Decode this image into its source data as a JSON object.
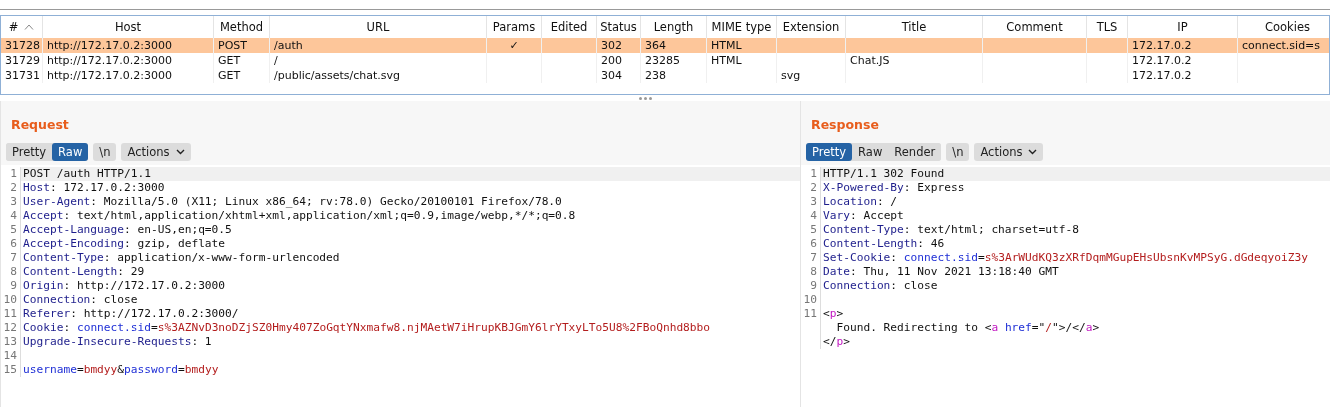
{
  "table": {
    "columns": [
      {
        "label": "#",
        "sorted": true
      },
      {
        "label": "Host",
        "sorted": false
      },
      {
        "label": "Method",
        "sorted": false
      },
      {
        "label": "URL",
        "sorted": false
      },
      {
        "label": "Params",
        "sorted": false
      },
      {
        "label": "Edited",
        "sorted": false
      },
      {
        "label": "Status",
        "sorted": false
      },
      {
        "label": "Length",
        "sorted": false
      },
      {
        "label": "MIME type",
        "sorted": false
      },
      {
        "label": "Extension",
        "sorted": false
      },
      {
        "label": "Title",
        "sorted": false
      },
      {
        "label": "Comment",
        "sorted": false
      },
      {
        "label": "TLS",
        "sorted": false
      },
      {
        "label": "IP",
        "sorted": false
      },
      {
        "label": "Cookies",
        "sorted": false
      }
    ],
    "rows": [
      {
        "selected": true,
        "cells": [
          "31728",
          "http://172.17.0.2:3000",
          "POST",
          "/auth",
          "✓",
          null,
          "302",
          "364",
          "HTML",
          null,
          null,
          null,
          null,
          "172.17.0.2",
          "connect.sid=s"
        ]
      },
      {
        "selected": false,
        "cells": [
          "31729",
          "http://172.17.0.2:3000",
          "GET",
          "/",
          null,
          null,
          "200",
          "23285",
          "HTML",
          null,
          "Chat.JS",
          null,
          null,
          "172.17.0.2",
          null
        ]
      },
      {
        "selected": false,
        "cells": [
          "31731",
          "http://172.17.0.2:3000",
          "GET",
          "/public/assets/chat.svg",
          null,
          null,
          "304",
          "238",
          null,
          "svg",
          null,
          null,
          null,
          "172.17.0.2",
          null
        ]
      }
    ]
  },
  "panes": [
    {
      "title": "Request",
      "views": [
        {
          "label": "Pretty",
          "selected": false
        },
        {
          "label": "Raw",
          "selected": true
        }
      ],
      "newline_button": "\\n",
      "actions_button": "Actions",
      "lines": [
        {
          "number": "1",
          "highlighted": true,
          "segments": [
            {
              "kind": "plain",
              "text": "POST /auth HTTP/1.1"
            }
          ]
        },
        {
          "number": "2",
          "highlighted": false,
          "segments": [
            {
              "kind": "name",
              "text": "Host"
            },
            {
              "kind": "plain",
              "text": ": 172.17.0.2:3000"
            }
          ]
        },
        {
          "number": "3",
          "highlighted": false,
          "segments": [
            {
              "kind": "name",
              "text": "User-Agent"
            },
            {
              "kind": "plain",
              "text": ": Mozilla/5.0 (X11; Linux x86_64; rv:78.0) Gecko/20100101 Firefox/78.0"
            }
          ]
        },
        {
          "number": "4",
          "highlighted": false,
          "segments": [
            {
              "kind": "name",
              "text": "Accept"
            },
            {
              "kind": "plain",
              "text": ": text/html,application/xhtml+xml,application/xml;q=0.9,image/webp,*/*;q=0.8"
            }
          ]
        },
        {
          "number": "5",
          "highlighted": false,
          "segments": [
            {
              "kind": "name",
              "text": "Accept-Language"
            },
            {
              "kind": "plain",
              "text": ": en-US,en;q=0.5"
            }
          ]
        },
        {
          "number": "6",
          "highlighted": false,
          "segments": [
            {
              "kind": "name",
              "text": "Accept-Encoding"
            },
            {
              "kind": "plain",
              "text": ": gzip, deflate"
            }
          ]
        },
        {
          "number": "7",
          "highlighted": false,
          "segments": [
            {
              "kind": "name",
              "text": "Content-Type"
            },
            {
              "kind": "plain",
              "text": ": application/x-www-form-urlencoded"
            }
          ]
        },
        {
          "number": "8",
          "highlighted": false,
          "segments": [
            {
              "kind": "name",
              "text": "Content-Length"
            },
            {
              "kind": "plain",
              "text": ": 29"
            }
          ]
        },
        {
          "number": "9",
          "highlighted": false,
          "segments": [
            {
              "kind": "name",
              "text": "Origin"
            },
            {
              "kind": "plain",
              "text": ": http://172.17.0.2:3000"
            }
          ]
        },
        {
          "number": "10",
          "highlighted": false,
          "segments": [
            {
              "kind": "name",
              "text": "Connection"
            },
            {
              "kind": "plain",
              "text": ": close"
            }
          ]
        },
        {
          "number": "11",
          "highlighted": false,
          "segments": [
            {
              "kind": "name",
              "text": "Referer"
            },
            {
              "kind": "plain",
              "text": ": http://172.17.0.2:3000/"
            }
          ]
        },
        {
          "number": "12",
          "highlighted": false,
          "segments": [
            {
              "kind": "name",
              "text": "Cookie"
            },
            {
              "kind": "plain",
              "text": ": "
            },
            {
              "kind": "attr",
              "text": "connect.sid"
            },
            {
              "kind": "plain",
              "text": "="
            },
            {
              "kind": "value",
              "text": "s%3AZNvD3noDZjSZ0Hmy407ZoGqtYNxmafw8.njMAetW7iHrupKBJGmY6lrYTxyLTo5U8%2FBoQnhd8bbo"
            }
          ]
        },
        {
          "number": "13",
          "highlighted": false,
          "segments": [
            {
              "kind": "name",
              "text": "Upgrade-Insecure-Requests"
            },
            {
              "kind": "plain",
              "text": ": 1"
            }
          ]
        },
        {
          "number": "14",
          "highlighted": false
        },
        {
          "number": "15",
          "highlighted": false,
          "segments": [
            {
              "kind": "attr",
              "text": "username"
            },
            {
              "kind": "plain",
              "text": "="
            },
            {
              "kind": "value",
              "text": "bmdyy"
            },
            {
              "kind": "plain",
              "text": "&"
            },
            {
              "kind": "attr",
              "text": "password"
            },
            {
              "kind": "plain",
              "text": "="
            },
            {
              "kind": "value",
              "text": "bmdyy"
            }
          ]
        }
      ]
    },
    {
      "title": "Response",
      "views": [
        {
          "label": "Pretty",
          "selected": true
        },
        {
          "label": "Raw",
          "selected": false
        },
        {
          "label": "Render",
          "selected": false
        }
      ],
      "newline_button": "\\n",
      "actions_button": "Actions",
      "lines": [
        {
          "number": "1",
          "highlighted": true,
          "segments": [
            {
              "kind": "plain",
              "text": "HTTP/1.1 302 Found"
            }
          ]
        },
        {
          "number": "2",
          "highlighted": false,
          "segments": [
            {
              "kind": "name",
              "text": "X-Powered-By"
            },
            {
              "kind": "plain",
              "text": ": Express"
            }
          ]
        },
        {
          "number": "3",
          "highlighted": false,
          "segments": [
            {
              "kind": "name",
              "text": "Location"
            },
            {
              "kind": "plain",
              "text": ": /"
            }
          ]
        },
        {
          "number": "4",
          "highlighted": false,
          "segments": [
            {
              "kind": "name",
              "text": "Vary"
            },
            {
              "kind": "plain",
              "text": ": Accept"
            }
          ]
        },
        {
          "number": "5",
          "highlighted": false,
          "segments": [
            {
              "kind": "name",
              "text": "Content-Type"
            },
            {
              "kind": "plain",
              "text": ": text/html; charset=utf-8"
            }
          ]
        },
        {
          "number": "6",
          "highlighted": false,
          "segments": [
            {
              "kind": "name",
              "text": "Content-Length"
            },
            {
              "kind": "plain",
              "text": ": 46"
            }
          ]
        },
        {
          "number": "7",
          "highlighted": false,
          "segments": [
            {
              "kind": "name",
              "text": "Set-Cookie"
            },
            {
              "kind": "plain",
              "text": ": "
            },
            {
              "kind": "attr",
              "text": "connect.sid"
            },
            {
              "kind": "plain",
              "text": "="
            },
            {
              "kind": "value",
              "text": "s%3ArWUdKQ3zXRfDqmMGupEHsUbsnKvMPSyG.dGdeqyoiZ3y"
            }
          ]
        },
        {
          "number": "8",
          "highlighted": false,
          "segments": [
            {
              "kind": "name",
              "text": "Date"
            },
            {
              "kind": "plain",
              "text": ": Thu, 11 Nov 2021 13:18:40 GMT"
            }
          ]
        },
        {
          "number": "9",
          "highlighted": false,
          "segments": [
            {
              "kind": "name",
              "text": "Connection"
            },
            {
              "kind": "plain",
              "text": ": close"
            }
          ]
        },
        {
          "number": "10",
          "highlighted": false
        },
        {
          "number": "11",
          "highlighted": false,
          "segments": [
            {
              "kind": "plain",
              "text": "<"
            },
            {
              "kind": "tag",
              "text": "p"
            },
            {
              "kind": "plain",
              "text": ">"
            }
          ]
        },
        {
          "highlighted": false,
          "segments": [
            {
              "kind": "plain",
              "text": "  Found. Redirecting to <"
            },
            {
              "kind": "tag",
              "text": "a"
            },
            {
              "kind": "attr",
              "text": " href"
            },
            {
              "kind": "plain",
              "text": "=\""
            },
            {
              "kind": "value",
              "text": "/"
            },
            {
              "kind": "plain",
              "text": "\">/</"
            },
            {
              "kind": "tag",
              "text": "a"
            },
            {
              "kind": "plain",
              "text": ">"
            }
          ]
        },
        {
          "highlighted": false,
          "segments": [
            {
              "kind": "plain",
              "text": "</"
            },
            {
              "kind": "tag",
              "text": "p"
            },
            {
              "kind": "plain",
              "text": ">"
            }
          ]
        }
      ]
    }
  ]
}
